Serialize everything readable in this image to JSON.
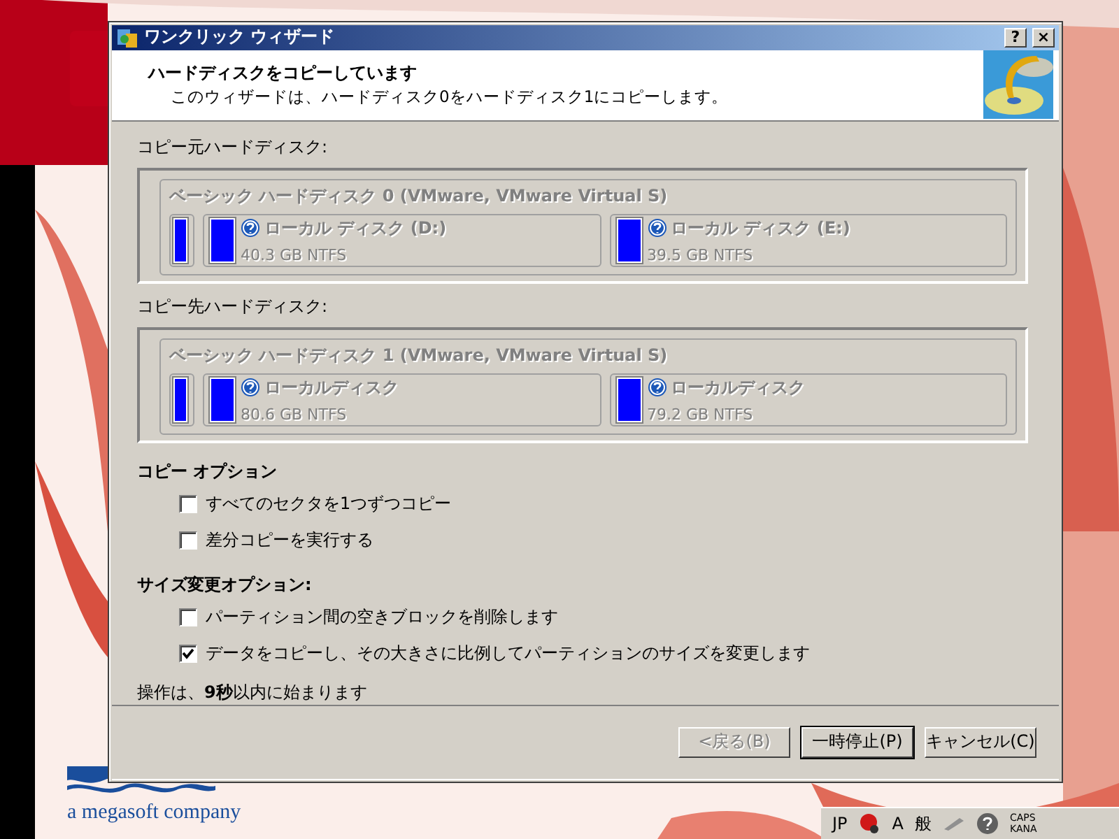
{
  "window": {
    "title": "ワンクリック ウィザード",
    "controls": [
      "?",
      "×"
    ]
  },
  "header": {
    "title": "ハードディスクをコピーしています",
    "subtitle": "このウィザードは、ハードディスク0をハードディスク1にコピーします。"
  },
  "disks": [
    {
      "label": "コピー元ハードディスク:",
      "title": "ベーシック ハードディスク 0 (VMware, VMware Virtual S)",
      "partitions": [
        {
          "kind": "small"
        },
        {
          "kind": "volume",
          "name": "ローカル ディスク (D:)",
          "size": "40.3 GB NTFS"
        },
        {
          "kind": "volume",
          "name": "ローカル ディスク (E:)",
          "size": "39.5 GB NTFS"
        }
      ]
    },
    {
      "label": "コピー先ハードディスク:",
      "title": "ベーシック ハードディスク 1 (VMware, VMware Virtual S)",
      "partitions": [
        {
          "kind": "small"
        },
        {
          "kind": "volume",
          "name": "ローカルディスク",
          "size": "80.6 GB NTFS"
        },
        {
          "kind": "volume",
          "name": "ローカルディスク",
          "size": "79.2 GB NTFS"
        }
      ]
    }
  ],
  "option_groups": [
    {
      "title": "コピー オプション",
      "options": [
        {
          "label": "すべてのセクタを1つずつコピー",
          "checked": false
        },
        {
          "label": "差分コピーを実行する",
          "checked": false
        }
      ]
    },
    {
      "title": "サイズ変更オプション:",
      "options": [
        {
          "label": "パーティション間の空きブロックを削除します",
          "checked": false
        },
        {
          "label": "データをコピーし、その大きさに比例してパーティションのサイズを変更します",
          "checked": true
        }
      ]
    }
  ],
  "status": "操作は、**9秒**以内に始まります",
  "buttons": [
    {
      "label": "<戻る(B)",
      "disabled": true,
      "default": false
    },
    {
      "label": "一時停止(P)",
      "disabled": false,
      "default": true
    },
    {
      "label": "キャンセル(C)",
      "disabled": false,
      "default": false
    }
  ],
  "desktop": {
    "logo_tagline": "a megasoft company"
  },
  "language_bar": {
    "language": "JP",
    "input_mode": "A",
    "dictionary": "般",
    "indicators": [
      "CAPS",
      "KANA"
    ]
  }
}
